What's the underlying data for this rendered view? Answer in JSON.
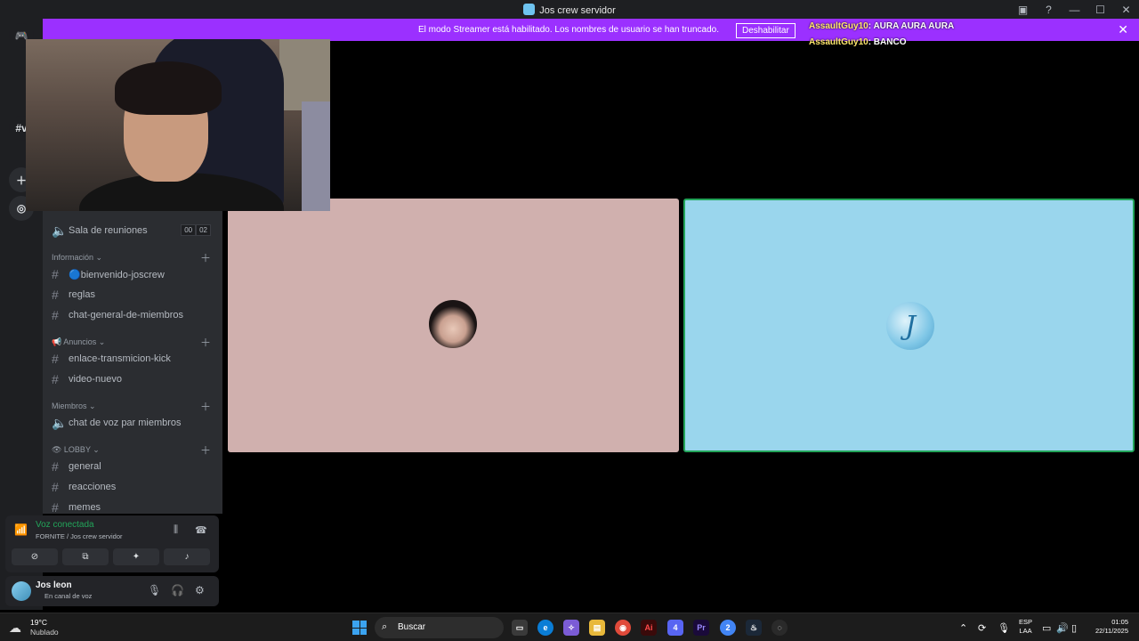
{
  "window": {
    "title": "Jos crew servidor"
  },
  "banner": {
    "message": "El modo Streamer está habilitado. Los nombres de usuario se han truncado.",
    "disable_label": "Deshabilitar"
  },
  "overlay_chat": [
    {
      "user": "AssaultGuy10",
      "text": ": AURA AURA AURA"
    },
    {
      "user": "AssaultGuy10",
      "text": ": BANCO"
    }
  ],
  "rail": {
    "hashtag_item": "#v"
  },
  "channels": {
    "voice_room": {
      "label": "Sala de reuniones",
      "count_a": "00",
      "count_b": "02"
    },
    "categories": [
      {
        "name": "Información ⌄",
        "channels": [
          "🔵bienvenido-joscrew",
          "reglas",
          "chat-general-de-miembros"
        ]
      },
      {
        "name": "📢 Anuncios ⌄",
        "channels": [
          "enlace-transmicion-kick",
          "video-nuevo"
        ]
      },
      {
        "name": "Miembros ⌄",
        "channels": [
          "chat de voz par miembros"
        ]
      },
      {
        "name": "👁 LOBBY ⌄",
        "channels": [
          "general",
          "reacciones",
          "memes"
        ]
      }
    ]
  },
  "voice": {
    "status": "Voz conectada",
    "location": "FORNITE / Jos crew servidor"
  },
  "user": {
    "name": "Jos leon",
    "status": "En canal de voz"
  },
  "taskbar": {
    "weather_temp": "19°C",
    "weather_cond": "Nublado",
    "search_placeholder": "Buscar",
    "lang_line1": "ESP",
    "lang_line2": "LAA",
    "time": "01:05",
    "date": "22/11/2025",
    "discord_badge": "4",
    "chrome_badge": "2"
  }
}
